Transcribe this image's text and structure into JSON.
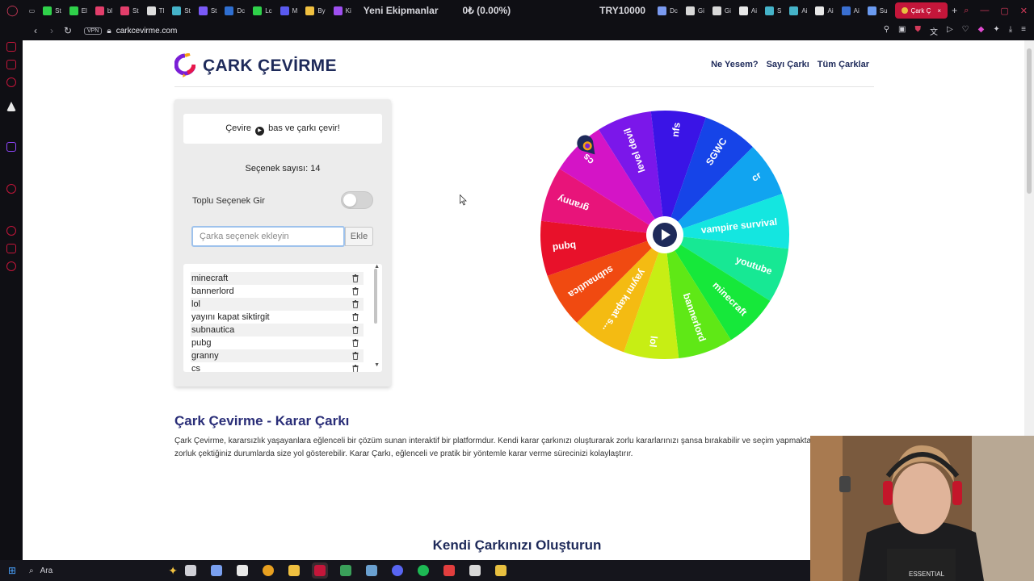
{
  "browser": {
    "tabs": [
      {
        "label": "St",
        "color": "#2fd14a"
      },
      {
        "label": "El",
        "color": "#2fd14a"
      },
      {
        "label": "bl",
        "color": "#e23e6b"
      },
      {
        "label": "St",
        "color": "#e23e6b"
      },
      {
        "label": "Tl",
        "color": "#dddddd"
      },
      {
        "label": "St",
        "color": "#45b3c9"
      },
      {
        "label": "St",
        "color": "#7a5af8"
      },
      {
        "label": "Dc",
        "color": "#2f6fd1"
      },
      {
        "label": "Lc",
        "color": "#2fd14a"
      },
      {
        "label": "M",
        "color": "#5a5af0"
      },
      {
        "label": "By",
        "color": "#f0c040"
      },
      {
        "label": "Ki",
        "color": "#9e4ff0"
      }
    ],
    "ticker_1": "Yeni Ekipmanlar",
    "ticker_2": "0₺ (0.00%)",
    "ticker_3": "TRY10000",
    "tabs_right": [
      {
        "label": "Dc",
        "color": "#7a9af0"
      },
      {
        "label": "Gi",
        "color": "#d8d8d8"
      },
      {
        "label": "Gi",
        "color": "#d8d8d8"
      },
      {
        "label": "Ai",
        "color": "#e8e8e8"
      },
      {
        "label": "S",
        "color": "#45b3c9"
      },
      {
        "label": "Ai",
        "color": "#45b3c9"
      },
      {
        "label": "Ai",
        "color": "#e8e8e8"
      },
      {
        "label": "Ai",
        "color": "#3a6fd1"
      },
      {
        "label": "Su",
        "color": "#6a9af0"
      }
    ],
    "active_tab": "Çark Ç",
    "url": "carkcevirme.com",
    "vpn": "VPN"
  },
  "site": {
    "logo": "ÇARK ÇEVİRME",
    "nav": [
      "Ne Yesem?",
      "Sayı Çarkı",
      "Tüm Çarklar"
    ]
  },
  "panel": {
    "hint_before": "Çevire",
    "hint_after": "bas ve çarkı çevir!",
    "count_text": "Seçenek sayısı: 14",
    "bulk_label": "Toplu Seçenek Gir",
    "bulk_enabled": false,
    "input_placeholder": "Çarka seçenek ekleyin",
    "add_label": "Ekle",
    "options": [
      "minecraft",
      "bannerlord",
      "lol",
      "yayını kapat siktirgit",
      "subnautica",
      "pubg",
      "granny",
      "cs"
    ]
  },
  "wheel": {
    "segments": [
      {
        "label": "level devil",
        "color": "#7b17ea"
      },
      {
        "label": "nfs",
        "color": "#3a14e6"
      },
      {
        "label": "SGWC",
        "color": "#1644e8"
      },
      {
        "label": "cr",
        "color": "#11a4f0"
      },
      {
        "label": "vampire survival",
        "color": "#14e6e0"
      },
      {
        "label": "youtube",
        "color": "#17e894"
      },
      {
        "label": "minecraft",
        "color": "#16e83a"
      },
      {
        "label": "bannerlord",
        "color": "#5fe816"
      },
      {
        "label": "lol",
        "color": "#c7ee14"
      },
      {
        "label": "yayını kapat s...",
        "color": "#f4bb12"
      },
      {
        "label": "subnautica",
        "color": "#f04a11"
      },
      {
        "label": "bqnd",
        "color": "#e8112a"
      },
      {
        "label": "granny",
        "color": "#e8147a"
      },
      {
        "label": "cs",
        "color": "#d414c6"
      }
    ]
  },
  "content": {
    "title": "Çark Çevirme - Karar Çarkı",
    "paragraph": "Çark Çevirme, kararsızlık yaşayanlara eğlenceli bir çözüm sunan interaktif bir platformdur. Kendi karar çarkınızı oluşturarak zorlu kararlarınızı şansa bırakabilir ve seçim yapmakta zorluk çektiğiniz durumlarda size yol gösterebilir. Karar Çarkı, eğlenceli ve pratik bir yöntemle karar verme sürecinizi kolaylaştırır.",
    "section2_title": "Kendi Çarkınızı Oluşturun"
  },
  "taskbar": {
    "search_label": "Ara",
    "apps": [
      {
        "name": "task-view",
        "color": "#cfcfd6"
      },
      {
        "name": "copilot",
        "color": "#7aa0f0"
      },
      {
        "name": "store",
        "color": "#e8e8e8"
      },
      {
        "name": "chrome",
        "color": "#e8a020"
      },
      {
        "name": "explorer",
        "color": "#f0c040"
      },
      {
        "name": "opera",
        "color": "#c4163a"
      },
      {
        "name": "app",
        "color": "#3aa05a"
      },
      {
        "name": "steam",
        "color": "#6aa0d0"
      },
      {
        "name": "discord",
        "color": "#5865f2"
      },
      {
        "name": "spotify",
        "color": "#1db954"
      },
      {
        "name": "app",
        "color": "#e23e3e"
      },
      {
        "name": "obs",
        "color": "#d8d8d8"
      },
      {
        "name": "app",
        "color": "#e8c040"
      }
    ]
  }
}
